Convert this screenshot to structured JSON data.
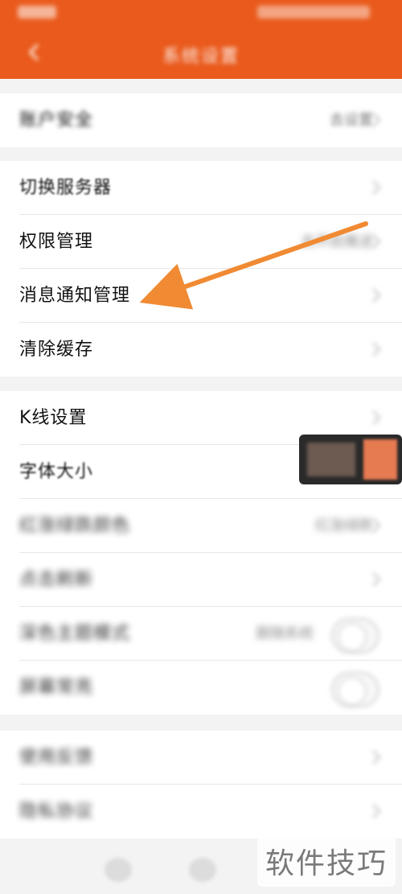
{
  "header": {
    "title": "系统设置"
  },
  "groups": [
    {
      "items": [
        {
          "label": "账户安全",
          "value": "去设置"
        }
      ]
    },
    {
      "items": [
        {
          "label": "切换服务器"
        },
        {
          "label": "权限管理",
          "value": "去开启推送"
        },
        {
          "label": "消息通知管理"
        },
        {
          "label": "清除缓存"
        }
      ]
    },
    {
      "items": [
        {
          "label": "K线设置"
        },
        {
          "label": "字体大小"
        },
        {
          "label": "红涨绿跌颜色",
          "value": "红涨绿跌"
        },
        {
          "label": "点击刷新"
        },
        {
          "label": "深色主题模式",
          "value": "跟随系统"
        },
        {
          "label": "屏幕常亮"
        }
      ]
    },
    {
      "items": [
        {
          "label": "使用反馈"
        },
        {
          "label": "隐私协议"
        }
      ]
    }
  ],
  "overlay": {
    "watermark": "软件技巧"
  },
  "colors": {
    "brand": "#ea5a1c",
    "arrow": "#f08a33"
  }
}
